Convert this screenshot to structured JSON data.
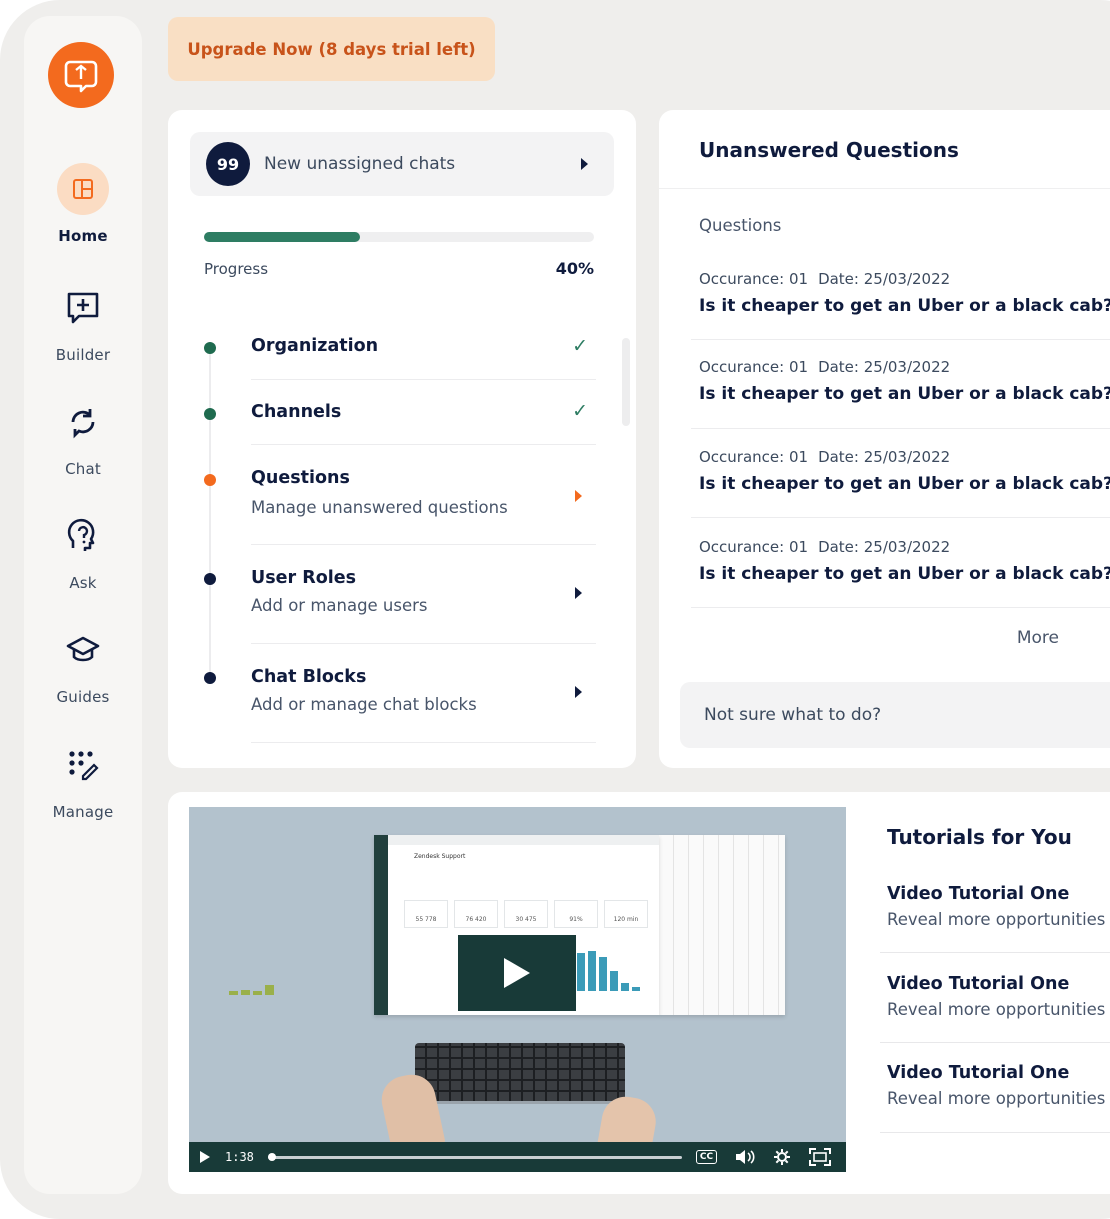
{
  "brand": {
    "accent": "#f36a1e",
    "navy": "#0f1b3d",
    "green": "#2e7d63"
  },
  "upgrade_label": "Upgrade Now (8 days trial left)",
  "sidebar": {
    "logo_icon": "chat-bubble-logo-icon",
    "items": [
      {
        "label": "Home",
        "icon": "layout-icon",
        "active": true
      },
      {
        "label": "Builder",
        "icon": "message-plus-icon",
        "active": false
      },
      {
        "label": "Chat",
        "icon": "refresh-chat-icon",
        "active": false
      },
      {
        "label": "Ask",
        "icon": "question-head-icon",
        "active": false
      },
      {
        "label": "Guides",
        "icon": "graduation-cap-icon",
        "active": false
      },
      {
        "label": "Manage",
        "icon": "grid-edit-icon",
        "active": false
      }
    ]
  },
  "setup": {
    "unassigned_count": "99",
    "unassigned_label": "New unassigned chats",
    "progress_label": "Progress",
    "progress_value": "40%",
    "progress_fraction": 0.4,
    "steps": [
      {
        "title": "Organization",
        "subtitle": "",
        "status": "done"
      },
      {
        "title": "Channels",
        "subtitle": "",
        "status": "done"
      },
      {
        "title": "Questions",
        "subtitle": "Manage unanswered questions",
        "status": "current"
      },
      {
        "title": "User Roles",
        "subtitle": "Add or manage users",
        "status": "todo"
      },
      {
        "title": "Chat Blocks",
        "subtitle": "Add or manage chat blocks",
        "status": "todo"
      }
    ]
  },
  "questions": {
    "title": "Unanswered Questions",
    "subtitle": "Questions",
    "items": [
      {
        "occurance": "Occurance: 01",
        "date": "Date: 25/03/2022",
        "text": "Is it cheaper to get an Uber or a black cab?"
      },
      {
        "occurance": "Occurance: 01",
        "date": "Date: 25/03/2022",
        "text": "Is it cheaper to get an Uber or a black cab?"
      },
      {
        "occurance": "Occurance: 01",
        "date": "Date: 25/03/2022",
        "text": "Is it cheaper to get an Uber or a black cab?"
      },
      {
        "occurance": "Occurance: 01",
        "date": "Date: 25/03/2022",
        "text": "Is it cheaper to get an Uber or a black cab?"
      }
    ],
    "more_label": "More",
    "help_label": "Not sure what to do?"
  },
  "video": {
    "time": "1:38",
    "cc_label": "CC",
    "screen_title": "Zendesk Support",
    "kpis": [
      "55 778",
      "76 420",
      "30 475",
      "91%",
      "120 min"
    ]
  },
  "tutorials": {
    "title": "Tutorials for You",
    "items": [
      {
        "title": "Video Tutorial One",
        "subtitle": "Reveal more opportunities"
      },
      {
        "title": "Video Tutorial One",
        "subtitle": "Reveal more opportunities"
      },
      {
        "title": "Video Tutorial One",
        "subtitle": "Reveal more opportunities"
      }
    ]
  }
}
